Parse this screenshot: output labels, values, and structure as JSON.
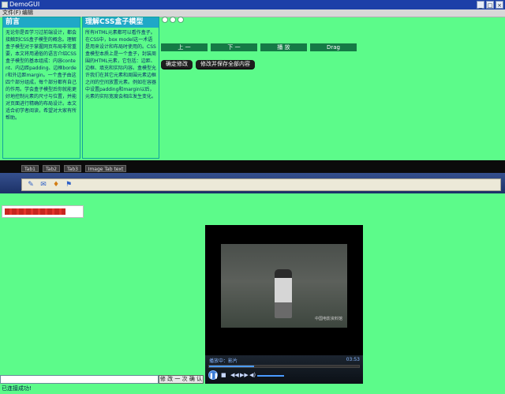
{
  "window": {
    "title": "DemoGUI",
    "controls": [
      "_",
      "□",
      "×"
    ]
  },
  "menu": [
    "文件(F)",
    "编辑"
  ],
  "panels": [
    {
      "title": "前言",
      "body": "无论你是否学习过前端设计，都会接触到CSS盒子模型的概念。理解盒子模型对于掌握网页布局非常重要，本文将用通俗的语言介绍CSS盒子模型的基本组成：内容content、内边距padding、边框border和外边距margin。一个盒子由这四个部分组成，每个部分都有自己的作用。学会盒子模型后你就能更好地控制元素的尺寸与位置，并能对页面进行精确的布局设计。本文适合初学者阅读，希望对大家有所帮助。"
    },
    {
      "title": "理解CSS盒子模型",
      "body": "所有HTML元素都可以看作盒子。在CSS中，box model这一术语是用来设计和布局时使用的。CSS盒模型本质上是一个盒子，封装周围的HTML元素，它包括：边距、边框、填充和实际内容。盒模型允许我们在其它元素和周围元素边框之间的空间放置元素。例如在容器中设置padding和margin以后，元素的实际宽度会相应发生变化。"
    }
  ],
  "tabs": [
    "上 一",
    "下 一",
    "播 放",
    "Drag"
  ],
  "actions": {
    "primary": "确定修改",
    "secondary": "修改并保存全部内容"
  },
  "strip_tabs": [
    "Tab1",
    "Tab2",
    "Tab3",
    "Image Tab text"
  ],
  "progress": {
    "fraction": 0.8
  },
  "player": {
    "info": "播放中：影片",
    "time": "03:53",
    "watermark": "中国电影资料馆",
    "seek_fraction": 0.3
  },
  "bottom": {
    "input_value": "",
    "button_label": "修 改 一 次 确 认"
  },
  "status": "已连接成功!"
}
